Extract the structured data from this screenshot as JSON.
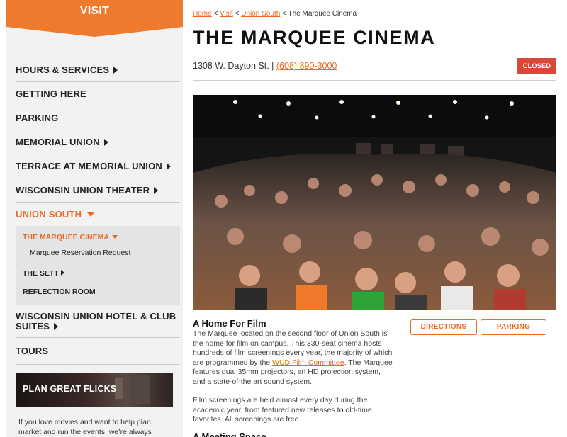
{
  "sidebar": {
    "banner": "VISIT",
    "items": [
      {
        "label": "HOURS & SERVICES"
      },
      {
        "label": "GETTING HERE"
      },
      {
        "label": "PARKING"
      },
      {
        "label": "MEMORIAL UNION"
      },
      {
        "label": "TERRACE AT MEMORIAL UNION"
      },
      {
        "label": "WISCONSIN UNION THEATER"
      },
      {
        "label": "UNION SOUTH"
      },
      {
        "label": "WISCONSIN UNION HOTEL & CLUB SUITES"
      },
      {
        "label": "TOURS"
      }
    ],
    "subitems": {
      "marquee": "THE MARQUEE CINEMA",
      "reservation": "Marquee Reservation Request",
      "sett": "THE SETT",
      "reflection": "REFLECTION ROOM"
    },
    "promo": {
      "title": "PLAN GREAT FLICKS",
      "text": "If you love movies and want to help plan, market and run the events, we’re always"
    }
  },
  "breadcrumb": {
    "home": "Home",
    "sep1": " < ",
    "visit": "Visit",
    "sep2": " < ",
    "union_south": "Union South",
    "current": " < The Marquee Cinema"
  },
  "page": {
    "title": "THE MARQUEE CINEMA",
    "address": "1308 W. Dayton St. | ",
    "phone": "(608) 890-3000",
    "status": "CLOSED"
  },
  "content": {
    "heading": "A Home For Film",
    "p1_a": "The Marquee located on the second floor of Union South is the home for film on campus. This 330-seat cinema hosts hundreds of film screenings every year, the majority of which are programmed by the ",
    "p1_link": "WUD Film Committee",
    "p1_b": ". The Marquee features dual 35mm projectors, an HD projection system, and a state-of-the art sound system.",
    "p2": "Film screenings are held almost every day during the academic year, from featured new releases to old-time favorites. All screenings are free.",
    "heading2": "A Meeting Space"
  },
  "buttons": {
    "directions": "DIRECTIONS",
    "parking": "PARKING"
  },
  "colors": {
    "accent": "#e86a26",
    "closed": "#d9473a"
  }
}
